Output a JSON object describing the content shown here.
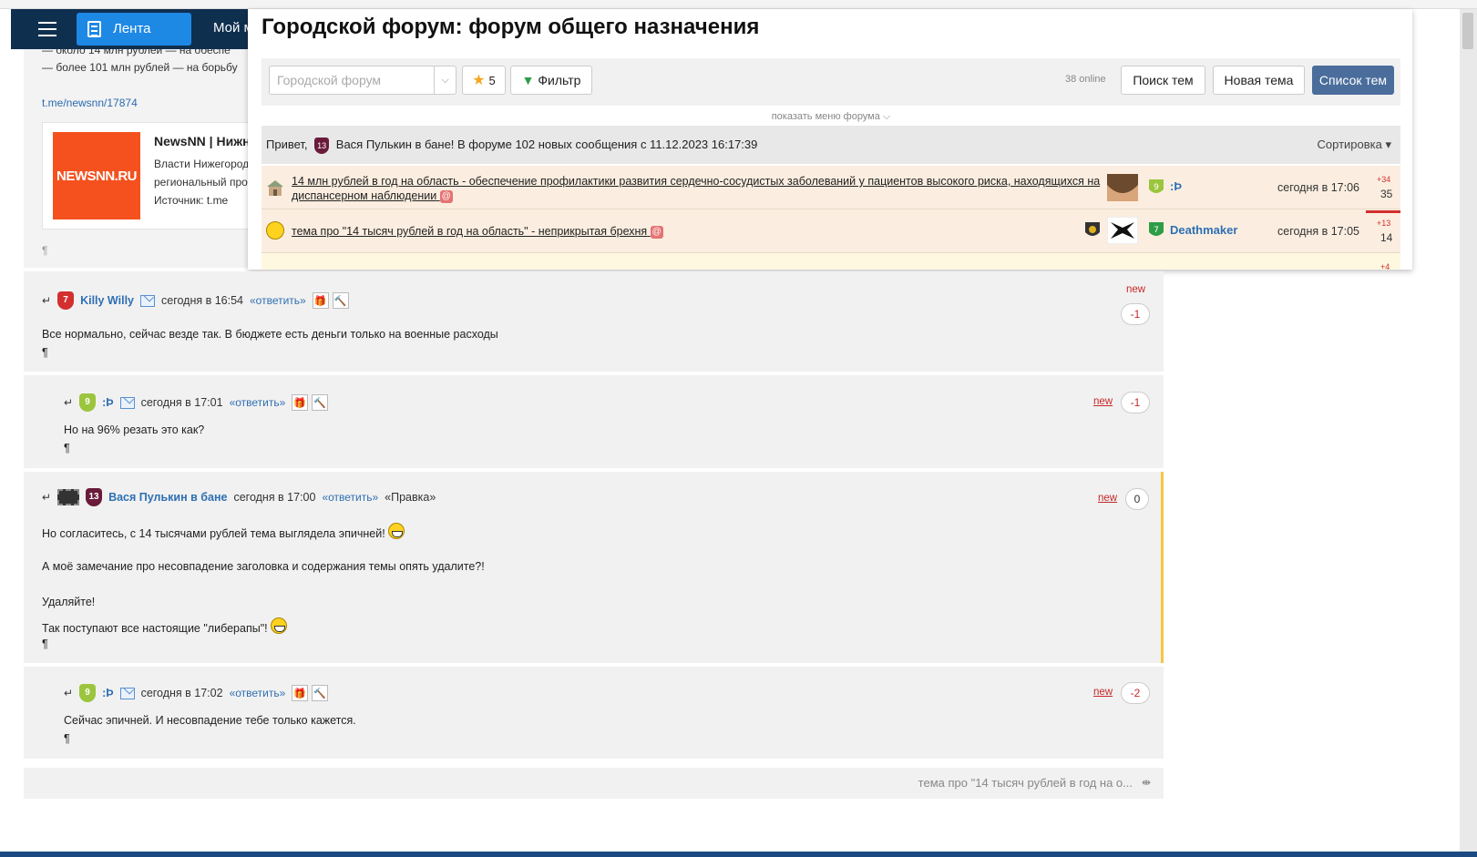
{
  "nav": {
    "lenta": "Лента",
    "moi": "Мой м"
  },
  "article": {
    "lines": [
      "— около 14 млн рублей — на обеспе",
      "— более 101 млн рублей — на борьбу"
    ],
    "link": "t.me/newsnn/17874",
    "card": {
      "logo": "NEWSNN.RU",
      "title": "NewsNN | Нижн",
      "text1": "Власти Нижегород",
      "text2": "региональный про",
      "source": "Источник: t.me"
    },
    "pilcrow": "¶"
  },
  "forum": {
    "title": "Городской форум: форум общего назначения",
    "select_value": "Городской форум",
    "select_arrow": "⌵",
    "stars": "5",
    "filter": "Фильтр",
    "online": "38 online",
    "search": "Поиск тем",
    "new_topic": "Новая тема",
    "topic_list": "Список тем",
    "show_menu": "показать меню форума  ⌵",
    "greeting_prefix": "Привет,",
    "greeting_badge": "13",
    "greeting_rest": "Вася Пулькин в бане! В форуме 102 новых сообщения с 11.12.2023 16:17:39",
    "sort": "Сортировка ▾",
    "topics": [
      {
        "title_line1": "14 млн рублей в год на область - обеспечение профилактики развития сердечно-сосудистых заболеваний у пациентов высокого риска, находящихся на",
        "title_line2": "диспансерном наблюдении",
        "user": ":Þ",
        "time": "сегодня в 17:06",
        "plus": "+34",
        "count": "35"
      },
      {
        "title_line1": "тема про \"14 тысяч рублей в год на область\" - неприкрытая брехня",
        "user": "Deathmaker",
        "time": "сегодня в 17:05",
        "plus": "+13",
        "count": "14"
      }
    ],
    "third_plus": "+4"
  },
  "comments": [
    {
      "author": "Killy Willy",
      "time": "сегодня в 16:54",
      "reply": "«ответить»",
      "text": "Все нормально, сейчас везде так. В бюджете есть деньги только на военные расходы",
      "new": "new",
      "score": "-1"
    },
    {
      "author": ":Þ",
      "time": "сегодня в 17:01",
      "reply": "«ответить»",
      "text": "Но на 96% резать это как?",
      "new": "new",
      "score": "-1"
    },
    {
      "author": "Вася Пулькин в бане",
      "badge": "13",
      "time": "сегодня в 17:00",
      "reply": "«ответить»",
      "edit": "«Правка»",
      "lines": [
        "Но согласитесь, с 14 тысячами рублей тема выглядела эпичней!",
        "А моё замечание про несовпадение заголовка и содержания темы опять удалите?!",
        "Удаляйте!",
        "Так поступают все настоящие \"либерапы\"!"
      ],
      "new": "new",
      "score": "0"
    },
    {
      "author": ":Þ",
      "time": "сегодня в 17:02",
      "reply": "«ответить»",
      "text": "Сейчас эпичней. И несовпадение тебе только кажется.",
      "new": "new",
      "score": "-2"
    }
  ],
  "pilcrow": "¶",
  "bottom": {
    "text": "тема про \"14 тысяч рублей в год на о...",
    "icon": "⇼"
  },
  "icons": {
    "arrow_back": "↵",
    "gift": "🎁",
    "hammer": "🔨"
  }
}
